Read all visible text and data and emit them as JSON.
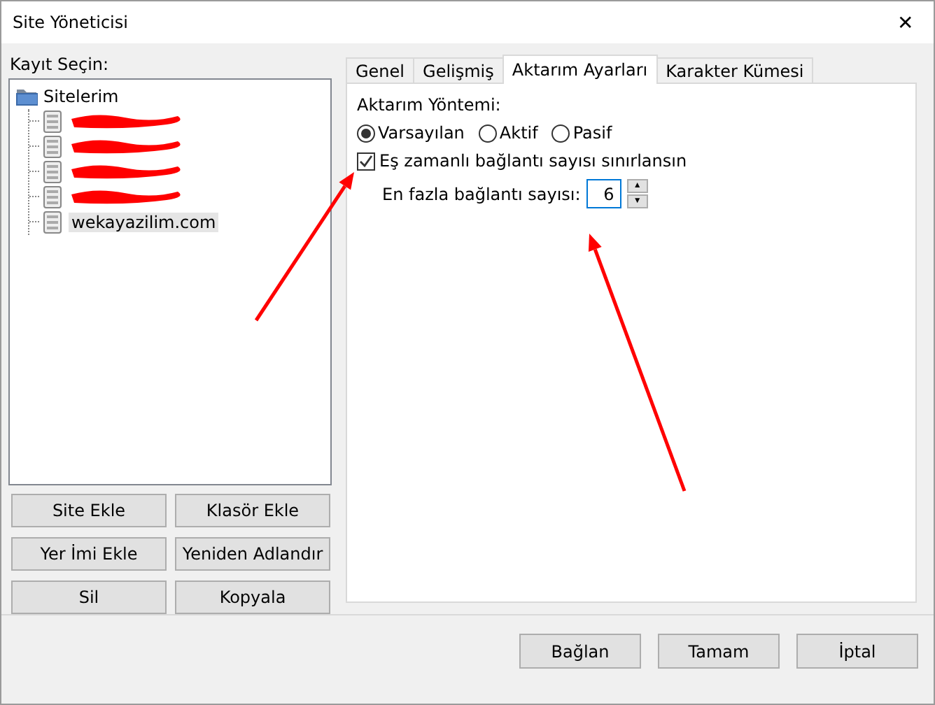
{
  "window": {
    "title": "Site Yöneticisi",
    "close": "✕"
  },
  "tree": {
    "label": "Kayıt Seçin:",
    "root": {
      "label": "Sitelerim",
      "children": [
        {
          "kind": "redacted",
          "selected": false
        },
        {
          "kind": "redacted",
          "selected": false
        },
        {
          "kind": "redacted",
          "selected": false
        },
        {
          "kind": "redacted",
          "selected": false
        },
        {
          "kind": "site",
          "label": "wekayazilim.com",
          "selected": true
        }
      ]
    }
  },
  "left_buttons": [
    "Site Ekle",
    "Klasör Ekle",
    "Yer İmi Ekle",
    "Yeniden Adlandır",
    "Sil",
    "Kopyala"
  ],
  "tabs": [
    {
      "label": "Genel",
      "selected": false
    },
    {
      "label": "Gelişmiş",
      "selected": false
    },
    {
      "label": "Aktarım Ayarları",
      "selected": true
    },
    {
      "label": "Karakter Kümesi",
      "selected": false
    }
  ],
  "transfer": {
    "mode_label": "Aktarım Yöntemi:",
    "modes": [
      {
        "label": "Varsayılan",
        "selected": true
      },
      {
        "label": "Aktif",
        "selected": false
      },
      {
        "label": "Pasif",
        "selected": false
      }
    ],
    "limit": {
      "label": "Eş zamanlı bağlantı sayısı sınırlansın",
      "checked": true
    },
    "max": {
      "label": "En fazla bağlantı sayısı:",
      "value": "6",
      "up": "▲",
      "down": "▼"
    }
  },
  "annotations": [
    {
      "kind": "arrow"
    },
    {
      "kind": "arrow"
    }
  ],
  "footer_buttons": [
    "Bağlan",
    "Tamam",
    "İptal"
  ]
}
